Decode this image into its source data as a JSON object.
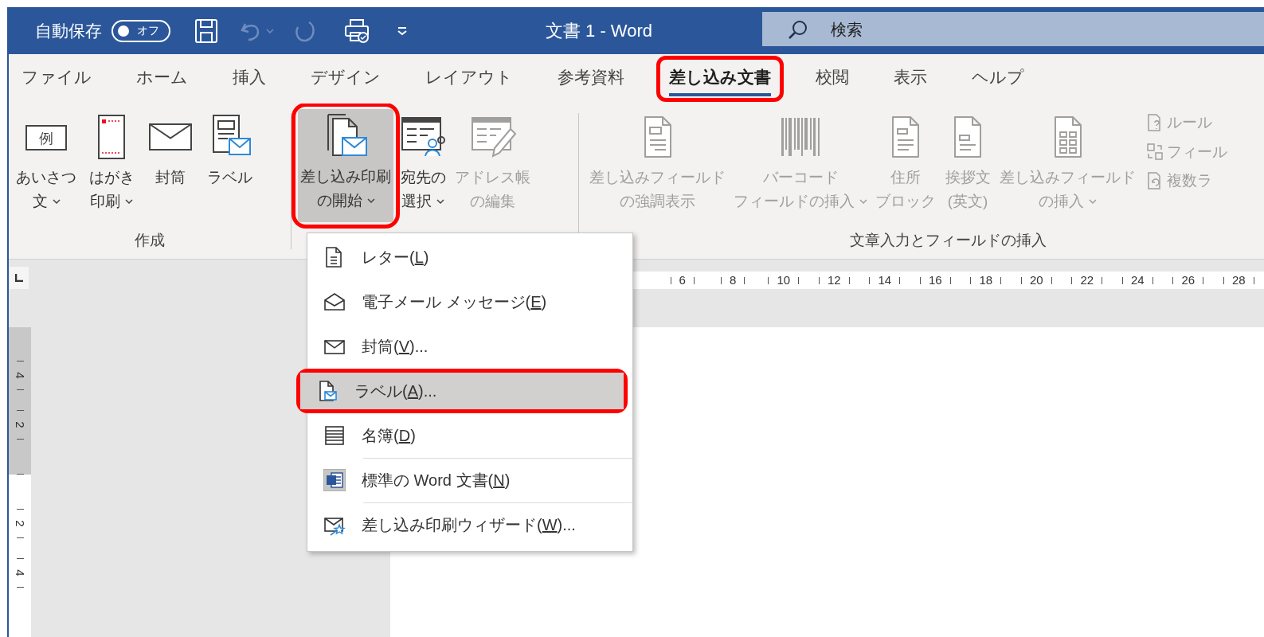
{
  "title_bar": {
    "autosave_label": "自動保存",
    "autosave_toggle": {
      "on": false,
      "text": "オフ"
    },
    "title": "文書 1 - Word",
    "search": {
      "placeholder": "検索"
    }
  },
  "tabs": [
    {
      "label": "ファイル",
      "selected": false,
      "highlighted": false
    },
    {
      "label": "ホーム",
      "selected": false,
      "highlighted": false
    },
    {
      "label": "挿入",
      "selected": false,
      "highlighted": false
    },
    {
      "label": "デザイン",
      "selected": false,
      "highlighted": false
    },
    {
      "label": "レイアウト",
      "selected": false,
      "highlighted": false
    },
    {
      "label": "参考資料",
      "selected": false,
      "highlighted": false
    },
    {
      "label": "差し込み文書",
      "selected": true,
      "highlighted": true
    },
    {
      "label": "校閲",
      "selected": false,
      "highlighted": false
    },
    {
      "label": "表示",
      "selected": false,
      "highlighted": false
    },
    {
      "label": "ヘルプ",
      "selected": false,
      "highlighted": false
    }
  ],
  "ribbon": {
    "groups": [
      {
        "label": "作成",
        "buttons": [
          {
            "lines": [
              "あいさつ",
              "文"
            ],
            "icon_text": "例",
            "dropdown": true,
            "disabled": false,
            "pressed": false,
            "highlighted": false
          },
          {
            "lines": [
              "はがき",
              "印刷"
            ],
            "dropdown": true,
            "disabled": false,
            "pressed": false,
            "highlighted": false
          },
          {
            "lines": [
              "封筒"
            ],
            "dropdown": false,
            "disabled": false,
            "pressed": false,
            "highlighted": false
          },
          {
            "lines": [
              "ラベル"
            ],
            "dropdown": false,
            "disabled": false,
            "pressed": false,
            "highlighted": false
          }
        ]
      },
      {
        "buttons": [
          {
            "lines": [
              "差し込み印刷",
              "の開始"
            ],
            "dropdown": true,
            "disabled": false,
            "pressed": true,
            "highlighted": true
          },
          {
            "lines": [
              "宛先の",
              "選択"
            ],
            "dropdown": true,
            "disabled": false,
            "pressed": false,
            "highlighted": false
          },
          {
            "lines": [
              "アドレス帳",
              "の編集"
            ],
            "dropdown": false,
            "disabled": true,
            "pressed": false,
            "highlighted": false
          }
        ]
      },
      {
        "label": "文章入力とフィールドの挿入",
        "buttons": [
          {
            "lines": [
              "差し込みフィールド",
              "の強調表示"
            ],
            "dropdown": false,
            "disabled": true,
            "pressed": false,
            "highlighted": false
          },
          {
            "lines": [
              "バーコード",
              "フィールドの挿入"
            ],
            "dropdown": true,
            "disabled": true,
            "pressed": false,
            "highlighted": false
          },
          {
            "lines": [
              "住所",
              "ブロック"
            ],
            "dropdown": false,
            "disabled": true,
            "pressed": false,
            "highlighted": false
          },
          {
            "lines": [
              "挨拶文",
              "(英文)"
            ],
            "dropdown": false,
            "disabled": true,
            "pressed": false,
            "highlighted": false
          },
          {
            "lines": [
              "差し込みフィールド",
              "の挿入"
            ],
            "dropdown": true,
            "disabled": true,
            "pressed": false,
            "highlighted": false
          }
        ],
        "small_buttons": [
          {
            "label": "ルール",
            "disabled": true
          },
          {
            "label": "フィール",
            "disabled": true
          },
          {
            "label": "複数ラ",
            "disabled": true
          }
        ]
      }
    ]
  },
  "ruler": {
    "horizontal_labels": [
      "6",
      "8",
      "10",
      "12",
      "14",
      "16",
      "18",
      "20",
      "22",
      "24",
      "26",
      "28"
    ],
    "vertical_labels": [
      "4",
      "2",
      "2",
      "4"
    ]
  },
  "menu": {
    "items": [
      {
        "label": "レター(",
        "access_key": "L",
        "suffix": ")",
        "selected": false,
        "highlighted": false,
        "separator_before": false
      },
      {
        "label": "電子メール メッセージ(",
        "access_key": "E",
        "suffix": ")",
        "selected": false,
        "highlighted": false,
        "separator_before": false
      },
      {
        "label": "封筒(",
        "access_key": "V",
        "suffix": ")...",
        "selected": false,
        "highlighted": false,
        "separator_before": false
      },
      {
        "label": "ラベル(",
        "access_key": "A",
        "suffix": ")...",
        "selected": true,
        "highlighted": true,
        "separator_before": false
      },
      {
        "label": "名簿(",
        "access_key": "D",
        "suffix": ")",
        "selected": false,
        "highlighted": false,
        "separator_before": false
      },
      {
        "label": "標準の Word 文書(",
        "access_key": "N",
        "suffix": ")",
        "selected": false,
        "highlighted": false,
        "separator_before": true
      },
      {
        "label": "差し込み印刷ウィザード(",
        "access_key": "W",
        "suffix": ")...",
        "selected": false,
        "highlighted": false,
        "separator_before": true
      }
    ]
  }
}
